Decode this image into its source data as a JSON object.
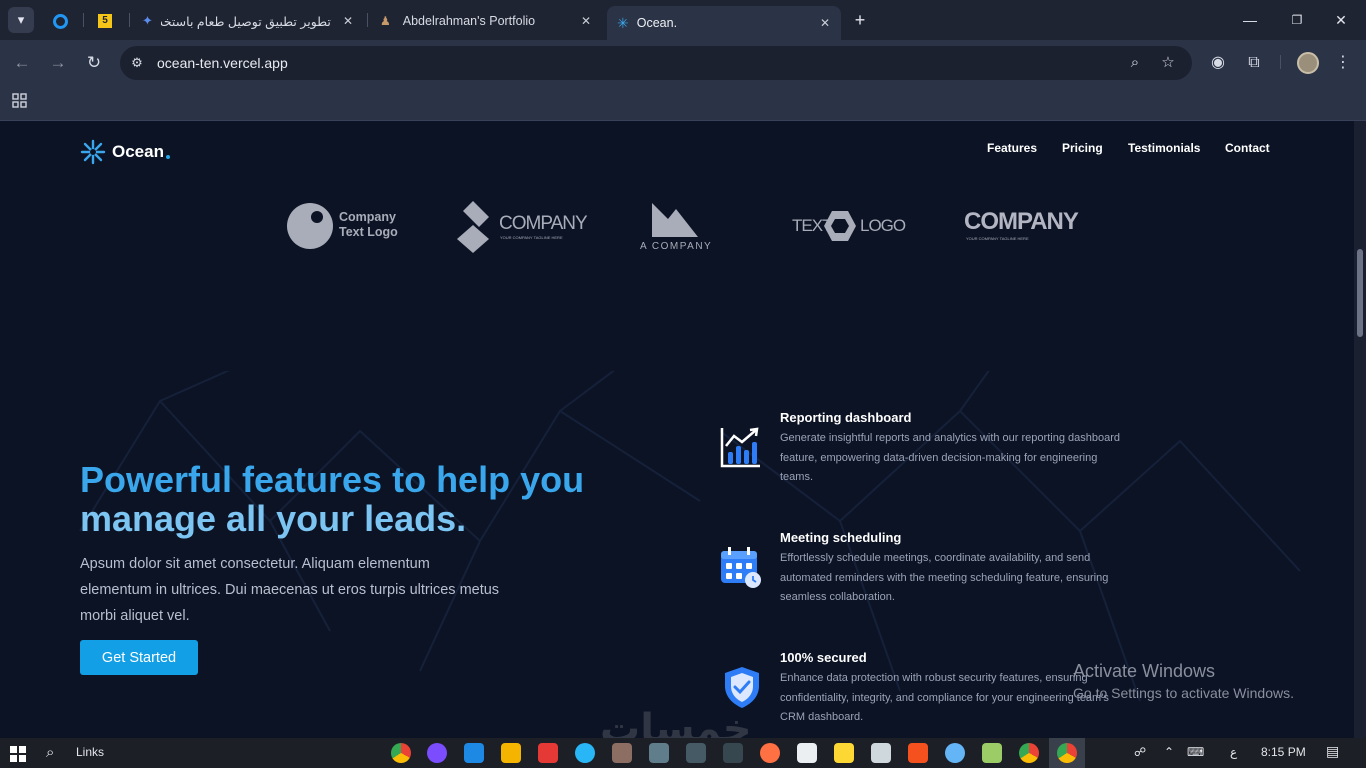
{
  "browser": {
    "tabs": [
      {
        "title": "",
        "favicon": "circle-icon",
        "color": "#2196f3"
      },
      {
        "title": "",
        "favicon": "html5-icon",
        "color": "#f5c518"
      },
      {
        "title": "تطوير تطبيق توصيل طعام باستخدام",
        "favicon": "bolt-icon",
        "color": "#5b8def"
      },
      {
        "title": "Abdelrahman's Portfolio",
        "favicon": "person-icon",
        "color": "#c89a6a"
      },
      {
        "title": "Ocean.",
        "favicon": "snowflake-icon",
        "color": "#3aa7ec"
      }
    ],
    "url": "ocean-ten.vercel.app"
  },
  "site": {
    "brand": "Ocean",
    "accent": "#139fe6",
    "nav": [
      "Features",
      "Pricing",
      "Testimonials",
      "Contact"
    ],
    "logos": {
      "logo1": {
        "line1": "Company",
        "line2": "Text Logo"
      },
      "logo2": {
        "text": "COMPANY",
        "tagline": "YOUR COMPANY TAGLINE HERE"
      },
      "logo3": {
        "text": "A COMPANY"
      },
      "logo4": {
        "left": "TEXT",
        "right": "LOGO"
      },
      "logo5": {
        "text": "COMPANY",
        "tagline": "YOUR COMPANY TAGLINE HERE"
      }
    },
    "hero": {
      "title_line1": "Powerful features to help you",
      "title_line2": "manage all your leads.",
      "description": "Apsum dolor sit amet consectetur. Aliquam elementum elementum in ultrices. Dui maecenas ut eros turpis ultrices metus morbi aliquet vel.",
      "cta": "Get Started"
    },
    "features": [
      {
        "title": "Reporting dashboard",
        "icon": "chart-icon",
        "description": "Generate insightful reports and analytics with our reporting dashboard feature, empowering data-driven decision-making for engineering teams."
      },
      {
        "title": "Meeting scheduling",
        "icon": "calendar-icon",
        "description": "Effortlessly schedule meetings, coordinate availability, and send automated reminders with the meeting scheduling feature, ensuring seamless collaboration."
      },
      {
        "title": "100% secured",
        "icon": "shield-icon",
        "description": "Enhance data protection with robust security features, ensuring confidentiality, integrity, and compliance for your engineering team's CRM dashboard."
      }
    ]
  },
  "watermark": {
    "line1": "Activate Windows",
    "line2": "Go to Settings to activate Windows.",
    "overlay": "خمسات"
  },
  "taskbar": {
    "search_label": "Links",
    "time": "8:15 PM",
    "lang": "ع"
  }
}
